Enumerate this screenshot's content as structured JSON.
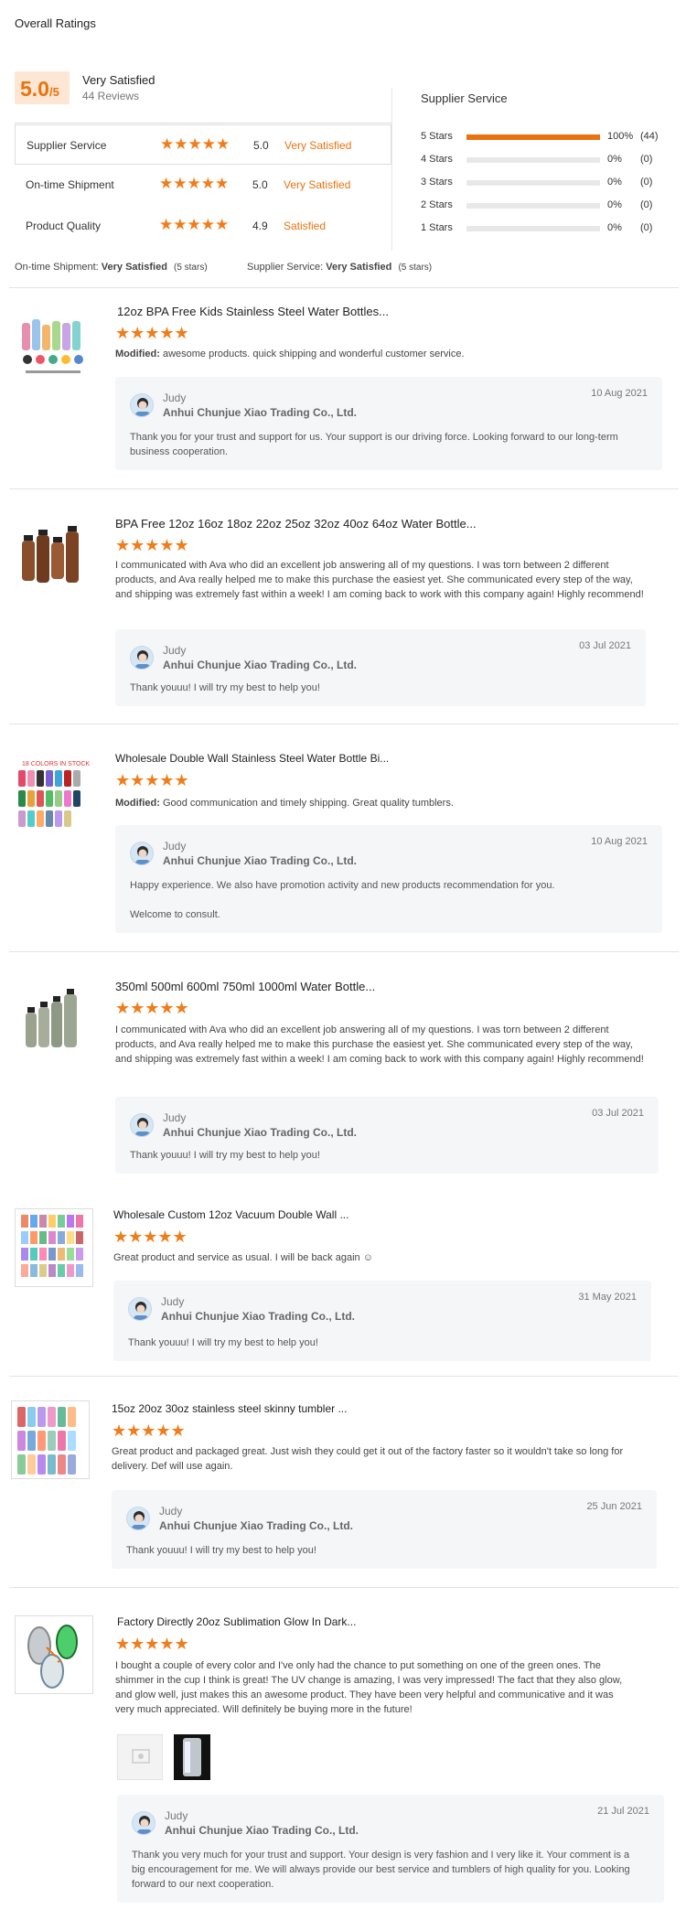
{
  "header": {
    "title": "Overall Ratings"
  },
  "summary": {
    "score": "5.0",
    "score_suffix": "/5",
    "label": "Very Satisfied",
    "reviews": "44 Reviews"
  },
  "metrics": [
    {
      "label": "Supplier Service",
      "score": "5.0",
      "word": "Very Satisfied",
      "stars": 5
    },
    {
      "label": "On-time Shipment",
      "score": "5.0",
      "word": "Very Satisfied",
      "stars": 5
    },
    {
      "label": "Product Quality",
      "score": "4.9",
      "word": "Satisfied",
      "stars": 5
    }
  ],
  "distribution": {
    "title": "Supplier Service",
    "rows": [
      {
        "label": "5 Stars",
        "pct": "100%",
        "count": "(44)",
        "fraction": 1.0
      },
      {
        "label": "4 Stars",
        "pct": "0%",
        "count": "(0)",
        "fraction": 0
      },
      {
        "label": "3 Stars",
        "pct": "0%",
        "count": "(0)",
        "fraction": 0
      },
      {
        "label": "2 Stars",
        "pct": "0%",
        "count": "(0)",
        "fraction": 0
      },
      {
        "label": "1 Stars",
        "pct": "0%",
        "count": "(0)",
        "fraction": 0
      }
    ]
  },
  "footnote": {
    "ontime_label": "On-time Shipment:",
    "ontime_value": "Very Satisfied",
    "ontime_stars": "(5 stars)",
    "service_label": "Supplier Service:",
    "service_value": "Very Satisfied",
    "service_stars": "(5 stars)"
  },
  "reviews": [
    {
      "title": "12oz BPA Free Kids Stainless Steel Water Bottles...",
      "modified_label": "Modified:",
      "text": "awesome products.  quick shipping and wonderful  customer  service.",
      "reply": {
        "name": "Judy",
        "company": "Anhui Chunjue Xiao Trading Co., Ltd.",
        "date": "10 Aug 2021",
        "text": "Thank you  for your trust and support for us. Your support is our driving force. Looking forward to our long-term business cooperation."
      }
    },
    {
      "title": "BPA Free 12oz 16oz 18oz 22oz 25oz 32oz 40oz 64oz Water Bottle...",
      "text": "I communicated with Ava who did an excellent job answering all of my questions. I was torn between 2 different products, and Ava really helped me to make this purchase the easiest yet. She communicated every step of the way, and shipping was extremely fast within a week! I am coming back to work with this company again! Highly recommend!",
      "reply": {
        "name": "Judy",
        "company": "Anhui Chunjue Xiao Trading Co., Ltd.",
        "date": "03 Jul 2021",
        "text": "Thank youuu! I will try my best to help you!"
      }
    },
    {
      "title": "Wholesale Double Wall Stainless Steel Water Bottle Bi...",
      "modified_label": "Modified:",
      "text": "Good communication and timely shipping. Great quality tumblers.",
      "reply": {
        "name": "Judy",
        "company": "Anhui Chunjue Xiao Trading Co., Ltd.",
        "date": "10 Aug 2021",
        "text": "Happy experience. We also have promotion activity and new products recommendation for you.",
        "text2": "Welcome to consult."
      }
    },
    {
      "title": "350ml 500ml 600ml 750ml 1000ml Water Bottle...",
      "text": "I communicated with Ava who did an excellent job answering all of my questions. I was torn between 2 different products, and Ava really helped me to make this purchase the easiest yet. She communicated every step of the way, and shipping was extremely fast within a week! I am coming back to work with this company again! Highly recommend!",
      "reply": {
        "name": "Judy",
        "company": "Anhui Chunjue Xiao Trading Co., Ltd.",
        "date": "03 Jul 2021",
        "text": "Thank youuu! I will try my best to help you!"
      }
    },
    {
      "title": "Wholesale Custom 12oz Vacuum Double Wall ...",
      "text": "Great product and service as usual. I will be back again ☺",
      "reply": {
        "name": "Judy",
        "company": "Anhui Chunjue Xiao Trading Co., Ltd.",
        "date": "31 May 2021",
        "text": "Thank youuu! I will try my best to help you!"
      }
    },
    {
      "title": "15oz 20oz 30oz stainless steel skinny tumbler ...",
      "text": "Great product and packaged great.  Just wish they could get it out of the factory faster so it wouldn't take so long for delivery.  Def will use again.",
      "reply": {
        "name": "Judy",
        "company": "Anhui Chunjue Xiao Trading Co., Ltd.",
        "date": "25 Jun 2021",
        "text": "Thank youuu! I will try my best to help you!"
      }
    },
    {
      "title": "Factory Directly 20oz Sublimation Glow In Dark...",
      "text": "I bought a couple of every color and I've only had the chance to put something on one of the green ones. The shimmer in the cup I think is great! The UV change is amazing, I was very impressed! The fact that they also glow, and glow well, just makes this an awesome product. They have been very helpful and communicative and it was very much appreciated. Will definitely be buying more in the future!",
      "reply": {
        "name": "Judy",
        "company": "Anhui Chunjue Xiao Trading Co., Ltd.",
        "date": "21 Jul 2021",
        "text": "Thank you very much for your trust and support. Your design is very fashion and I very like it. Your comment is a big encouragement for me. We will always provide our best service and tumblers of high quality for you. Looking forward to our next cooperation."
      }
    }
  ],
  "colors": {
    "accent": "#e8730f",
    "reply_bg": "#f5f6f8"
  },
  "icons": {
    "star": "star-icon",
    "avatar": "avatar"
  }
}
